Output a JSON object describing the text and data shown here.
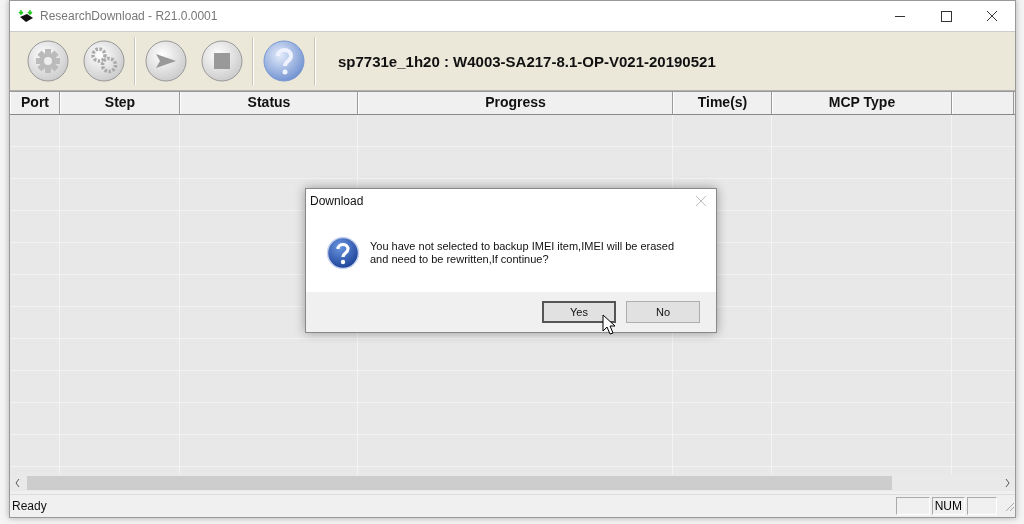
{
  "window": {
    "title": "ResearchDownload - R21.0.0001"
  },
  "toolbar": {
    "buttons": [
      {
        "kind": "gear"
      },
      {
        "kind": "gears"
      },
      {
        "kind": "play"
      },
      {
        "kind": "stop"
      },
      {
        "kind": "help"
      }
    ],
    "firmware": "sp7731e_1h20 : W4003-SA217-8.1-OP-V021-20190521"
  },
  "table": {
    "columns": [
      "Port",
      "Step",
      "Status",
      "Progress",
      "Time(s)",
      "MCP Type"
    ]
  },
  "dialog": {
    "kind": "question",
    "title": "Download",
    "message": "You have not selected to backup IMEI item,IMEI will be erased and need to be rewritten,If continue?",
    "buttons": [
      {
        "label": "Yes",
        "focused": true
      },
      {
        "label": "No",
        "focused": false
      }
    ]
  },
  "status_bar": {
    "text": "Ready",
    "indicators": [
      {
        "kind": "empty"
      },
      {
        "kind": "text",
        "text": "NUM"
      },
      {
        "kind": "empty"
      }
    ]
  }
}
